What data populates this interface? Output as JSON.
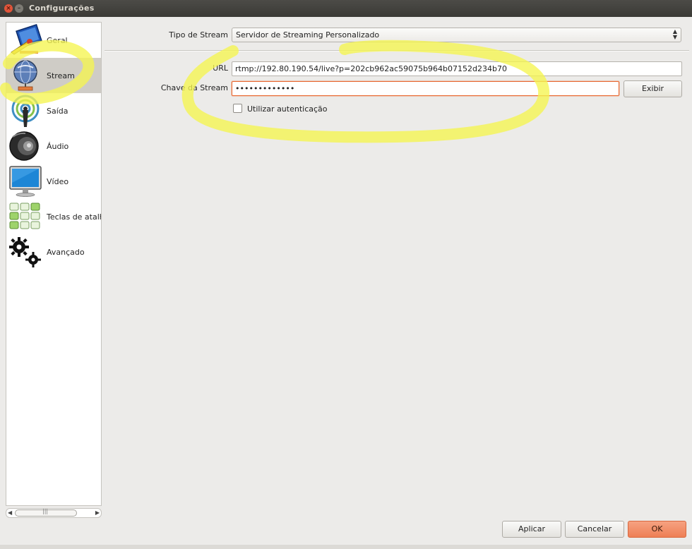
{
  "window": {
    "title": "Configurações",
    "close_glyph": "×",
    "min_glyph": "–"
  },
  "sidebar": {
    "items": [
      {
        "label": "Geral",
        "icon": "wrench-monitor-icon"
      },
      {
        "label": "Stream",
        "icon": "globe-network-icon",
        "selected": true
      },
      {
        "label": "Saída",
        "icon": "broadcast-antenna-icon"
      },
      {
        "label": "Áudio",
        "icon": "speaker-icon"
      },
      {
        "label": "Vídeo",
        "icon": "monitor-icon"
      },
      {
        "label": "Teclas de atalho",
        "icon": "keyboard-icon"
      },
      {
        "label": "Avançado",
        "icon": "gears-icon"
      }
    ],
    "scroll_left": "◀",
    "scroll_right": "▶",
    "scroll_grip": "|||"
  },
  "stream": {
    "type_label": "Tipo de Stream",
    "type_value": "Servidor de Streaming Personalizado",
    "type_arrows": "▲▼",
    "url_label": "URL",
    "url_value": "rtmp://192.80.190.54/live?p=202cb962ac59075b964b07152d234b70",
    "key_label": "Chave da Stream",
    "key_value": "•••••••••••••",
    "show_button": "Exibir",
    "auth_label": "Utilizar autenticação"
  },
  "footer": {
    "apply": "Aplicar",
    "cancel": "Cancelar",
    "ok": "OK"
  },
  "colors": {
    "accent": "#e9672f",
    "annotation": "#f5f550"
  }
}
